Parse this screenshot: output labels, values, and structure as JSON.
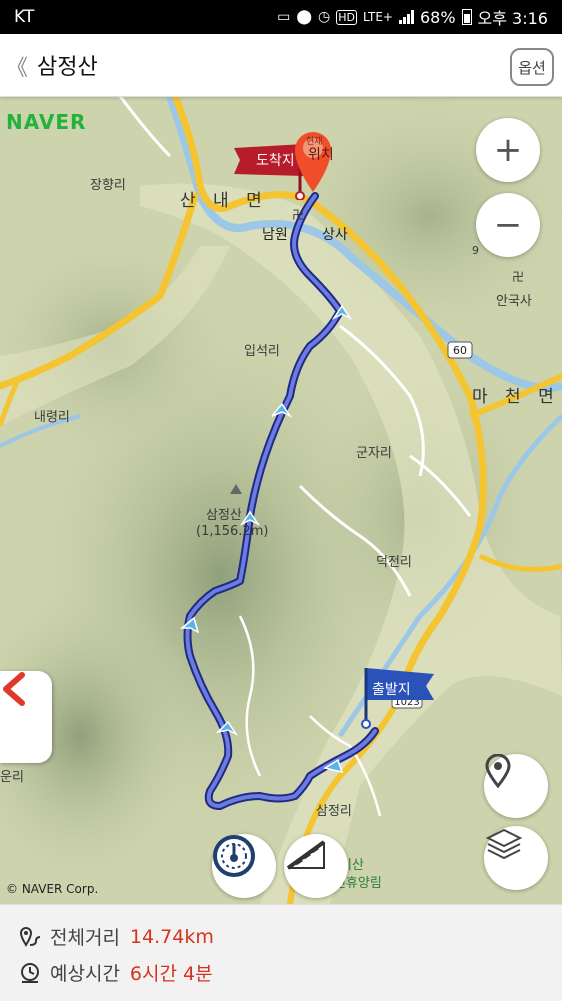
{
  "status_bar": {
    "carrier": "KT",
    "network": "LTE+",
    "battery": "68%",
    "time": "오후 3:16"
  },
  "header": {
    "back_label": "《",
    "title": "삼정산",
    "options_label": "옵션"
  },
  "map": {
    "logo": "NAVER",
    "copyright": "© NAVER Corp.",
    "places": {
      "janghang": "장향리",
      "sannae": "산 내 면",
      "namwon": "남원",
      "sangsa": "상사",
      "ipseok": "입석리",
      "naeryeong": "내령리",
      "samjeongsan": "삼정산",
      "elevation": "(1,156.2m)",
      "gunja": "군자리",
      "deokjeon": "덕전리",
      "macheon": "마 천 면",
      "anguksa": "안국사",
      "samjeong": "삼정리",
      "uri": "운리",
      "recreation_forest_1": "리산",
      "recreation_forest_2": "자연휴양림",
      "road_60": "60",
      "road_1023": "1023",
      "road_9": "9"
    },
    "markers": {
      "arrival_label": "도착지",
      "departure_label": "출발지",
      "current_location_label": "위치",
      "current_location_small": "현재"
    },
    "route_color": "#3b4fc4",
    "buttons": {
      "zoom_in_icon": "+",
      "zoom_out_icon": "−"
    }
  },
  "summary": {
    "distance_label": "전체거리",
    "distance_value": "14.74km",
    "time_label": "예상시간",
    "time_value": "6시간 4분"
  }
}
